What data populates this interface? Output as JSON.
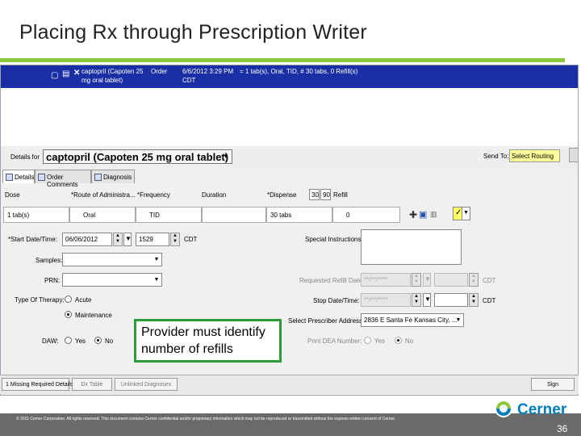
{
  "slide": {
    "title": "Placing Rx through Prescription Writer",
    "page_number": "36"
  },
  "order_row": {
    "name_line1": "captopril (Capoten 25",
    "name_line2": "mg oral tablet)",
    "order_label": "Order",
    "datetime": "6/6/2012 3:29 PM",
    "timezone": "CDT",
    "details": "= 1 tab(s), Oral, TID, # 30 tabs, 0 Refill(s)"
  },
  "details": {
    "label": "Details for",
    "medication": "captopril (Capoten 25 mg oral tablet)",
    "send_to_label": "Send To:",
    "send_to_value": "Select Routing"
  },
  "tabs": [
    {
      "label": "Details"
    },
    {
      "label": "Order Comments"
    },
    {
      "label": "Diagnosis"
    }
  ],
  "grid": {
    "headers": [
      "Dose",
      "*Route of Administra...",
      "*Frequency",
      "Duration",
      "*Dispense",
      "Refill"
    ],
    "dispense_boxes": [
      "30",
      "90"
    ],
    "values": [
      "1 tab(s)",
      "Oral",
      "TID",
      "",
      "30 tabs",
      "0"
    ]
  },
  "form": {
    "start_label": "*Start Date/Time:",
    "start_date": "06/06/2012",
    "start_time": "1529",
    "timezone": "CDT",
    "samples_label": "Samples:",
    "prn_label": "PRN:",
    "therapy_label": "Type Of Therapy:",
    "therapy_options": [
      "Acute",
      "Maintenance"
    ],
    "daw_label": "DAW:",
    "daw_options": [
      "Yes",
      "No"
    ],
    "special_label": "Special Instructions:",
    "req_refill_label": "Requested Refill Date:",
    "req_refill_value": "**/**/****",
    "stop_label": "Stop Date/Time:",
    "stop_value": "**/**/****",
    "prescriber_label": "Select Prescriber Address:",
    "prescriber_value": "2836 E Santa Fe Kansas City, ...",
    "dea_label": "Print DEA Number:",
    "dea_options": [
      "Yes",
      "No"
    ]
  },
  "bottom_bar": {
    "missing_details": "1 Missing Required Details",
    "buttons": [
      "Dx Table",
      "Unlinked Diagnoses"
    ],
    "sign": "Sign"
  },
  "callout": "Provider must identify number of refills",
  "footer": "© 2011 Cerner Corporation. All rights reserved. This document contains Cerner confidential and/or proprietary information which may not be reproduced or transmitted without the express written consent of Cerner.",
  "logo": "Cerner",
  "colors": {
    "accent_rule": "#8dc63f",
    "order_row": "#1a2ea5",
    "callout_border": "#2a9d3a",
    "send_to_bg": "#ffff99",
    "logo": "#007dba"
  }
}
